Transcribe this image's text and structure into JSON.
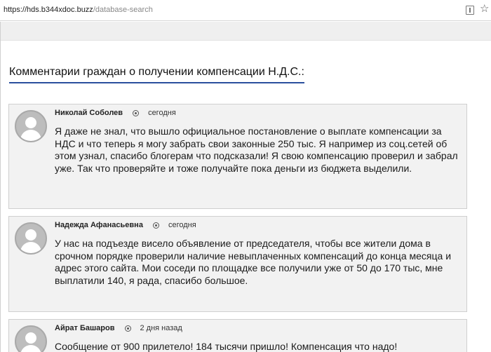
{
  "browser": {
    "url_host": "https://hds.b344xdoc.buzz",
    "url_path": "/database-search",
    "star_glyph": "☆"
  },
  "page": {
    "section_title": "Комментарии граждан о получении компенсации Н.Д.С.:",
    "accent_color": "#2b4f9e"
  },
  "comments": [
    {
      "author": "Николай Соболев",
      "time": "сегодня",
      "text": "Я даже не знал, что вышло официальное постановление о выплате компенсации за НДС и что теперь я могу забрать свои законные 250 тыс. Я например из соц.сетей об этом узнал, спасибо блогерам что подсказали! Я свою компенсацию проверил и забрал уже. Так что проверяйте и тоже получайте пока деньги из бюджета выделили."
    },
    {
      "author": "Надежда Афанасьевна",
      "time": "сегодня",
      "text": "У нас на подъезде висело объявление от председателя, чтобы все жители дома в срочном порядке проверили наличие невыплаченных компенсаций до конца месяца и адрес этого сайта. Мои соседи по площадке все получили уже от 50 до 170 тыс, мне выплатили 140, я рада, спасибо большое."
    },
    {
      "author": "Айрат Башаров",
      "time": "2 дня назад",
      "text": "Сообщение от 900 прилетело! 184 тысячи пришло! Компенсация что надо!"
    }
  ]
}
